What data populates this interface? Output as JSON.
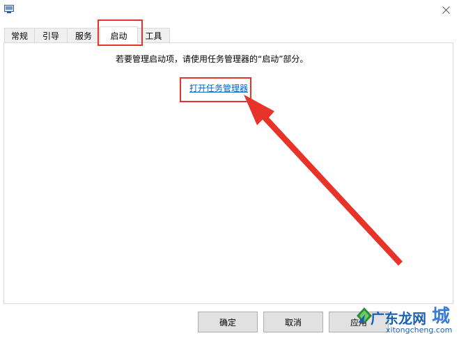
{
  "tabs": [
    {
      "label": "常规"
    },
    {
      "label": "引导"
    },
    {
      "label": "服务"
    },
    {
      "label": "启动",
      "active": true
    },
    {
      "label": "工具"
    }
  ],
  "startup": {
    "instruction": "若要管理启动项，请使用任务管理器的“启动”部分。",
    "link_label": "打开任务管理器"
  },
  "footer": {
    "ok_label": "确定",
    "cancel_label": "取消",
    "apply_label": "应用"
  },
  "watermark": {
    "brand": "广东龙网",
    "char": "城",
    "site": "xitongcheng.com"
  },
  "annotation_color": "#e8332b",
  "link_color": "#0066cc"
}
